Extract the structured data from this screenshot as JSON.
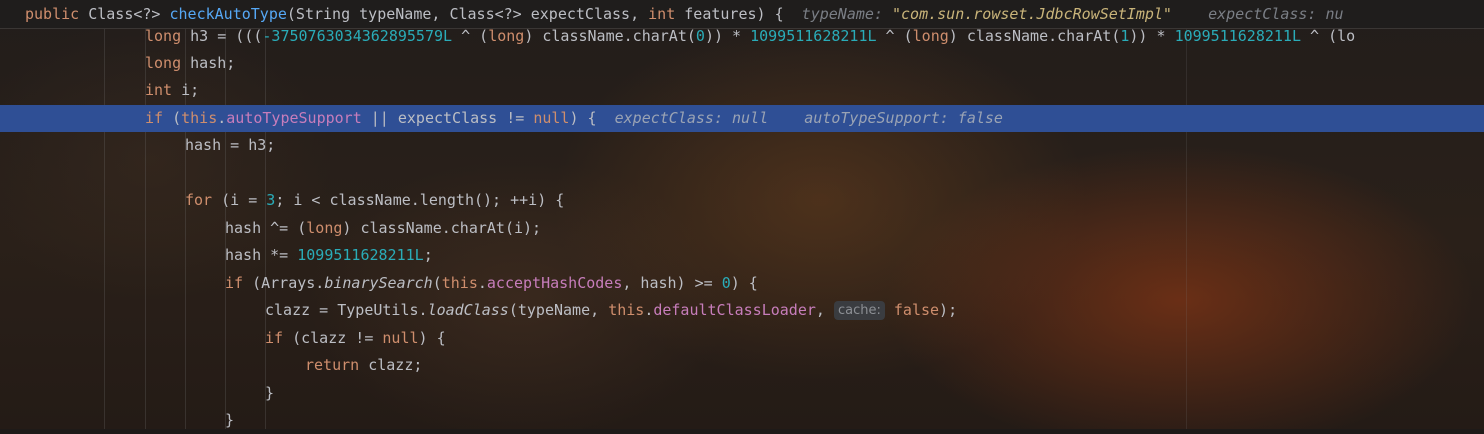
{
  "header": {
    "kw_public": "public",
    "ret_type": "Class<?>",
    "method_name": "checkAutoType",
    "params_pre": "(String typeName, Class<?> expectClass, ",
    "kw_int": "int",
    "params_post": " features) {",
    "hint1_label": "typeName:",
    "hint1_value": "\"com.sun.rowset.JdbcRowSetImpl\"",
    "hint2_label": "expectClass: nu"
  },
  "line_h3": {
    "kw_long": "long",
    "t1": " h3 = (((",
    "n1": "-3750763034362895579L",
    "t2": " ^ (",
    "kw_long2": "long",
    "t3": ") className.charAt(",
    "n2": "0",
    "t4": ")) * ",
    "n3": "1099511628211L",
    "t5": " ^ (",
    "kw_long3": "long",
    "t6": ") className.charAt(",
    "n4": "1",
    "t7": ")) * ",
    "n5": "1099511628211L",
    "t8": " ^ (lo"
  },
  "line_hash": {
    "kw": "long",
    "rest": " hash;"
  },
  "line_i": {
    "kw": "int",
    "rest": " i;"
  },
  "line_if": {
    "kw_if": "if",
    "t1": " (",
    "kw_this": "this",
    "dot": ".",
    "field": "autoTypeSupport",
    "t2": " || expectClass != ",
    "kw_null": "null",
    "t3": ") {",
    "hint1": "expectClass: null",
    "hint2": "autoTypeSupport: false"
  },
  "line_hash_h3": {
    "text": "hash = h3;"
  },
  "line_for": {
    "kw_for": "for",
    "t1": " (i = ",
    "n1": "3",
    "t2": "; i < className.length(); ++i) {"
  },
  "line_xor": {
    "t1": "hash ^= (",
    "kw": "long",
    "t2": ") className.charAt(i);"
  },
  "line_mul": {
    "t1": "hash *= ",
    "n1": "1099511628211L",
    "t2": ";"
  },
  "line_if2": {
    "kw_if": "if",
    "t1": " (Arrays.",
    "method": "binarySearch",
    "t2": "(",
    "kw_this": "this",
    "dot": ".",
    "field": "acceptHashCodes",
    "t3": ", hash) >= ",
    "n1": "0",
    "t4": ") {"
  },
  "line_clazz": {
    "t1": "clazz = TypeUtils.",
    "method": "loadClass",
    "t2": "(typeName, ",
    "kw_this": "this",
    "dot": ".",
    "field": "defaultClassLoader",
    "t3": ", ",
    "inlay": "cache:",
    "kw_false": "false",
    "t4": ");"
  },
  "line_if3": {
    "kw_if": "if",
    "t1": " (clazz != ",
    "kw_null": "null",
    "t2": ") {"
  },
  "line_return": {
    "kw": "return",
    "rest": " clazz;"
  },
  "line_close1": {
    "text": "}"
  },
  "line_close2": {
    "text": "}"
  }
}
